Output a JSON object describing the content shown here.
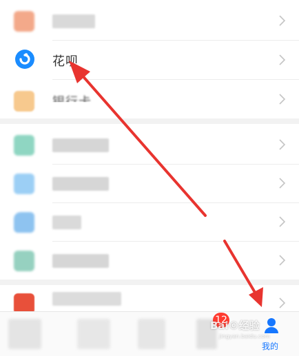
{
  "rows": {
    "huabei": {
      "label": "花呗",
      "icon": "huabei-icon"
    },
    "partial": {
      "label": "银行卡"
    }
  },
  "tabbar": {
    "mine_label": "我的",
    "mine_icon": "person-icon",
    "badge_count": "12"
  },
  "watermark": {
    "text": "Bai©经验",
    "sub": "jingyan.baidu.com"
  },
  "colors": {
    "accent": "#1677ff",
    "arrow": "#e8342f",
    "huabei": "#1a8cff",
    "badge": "#ff3b30"
  }
}
